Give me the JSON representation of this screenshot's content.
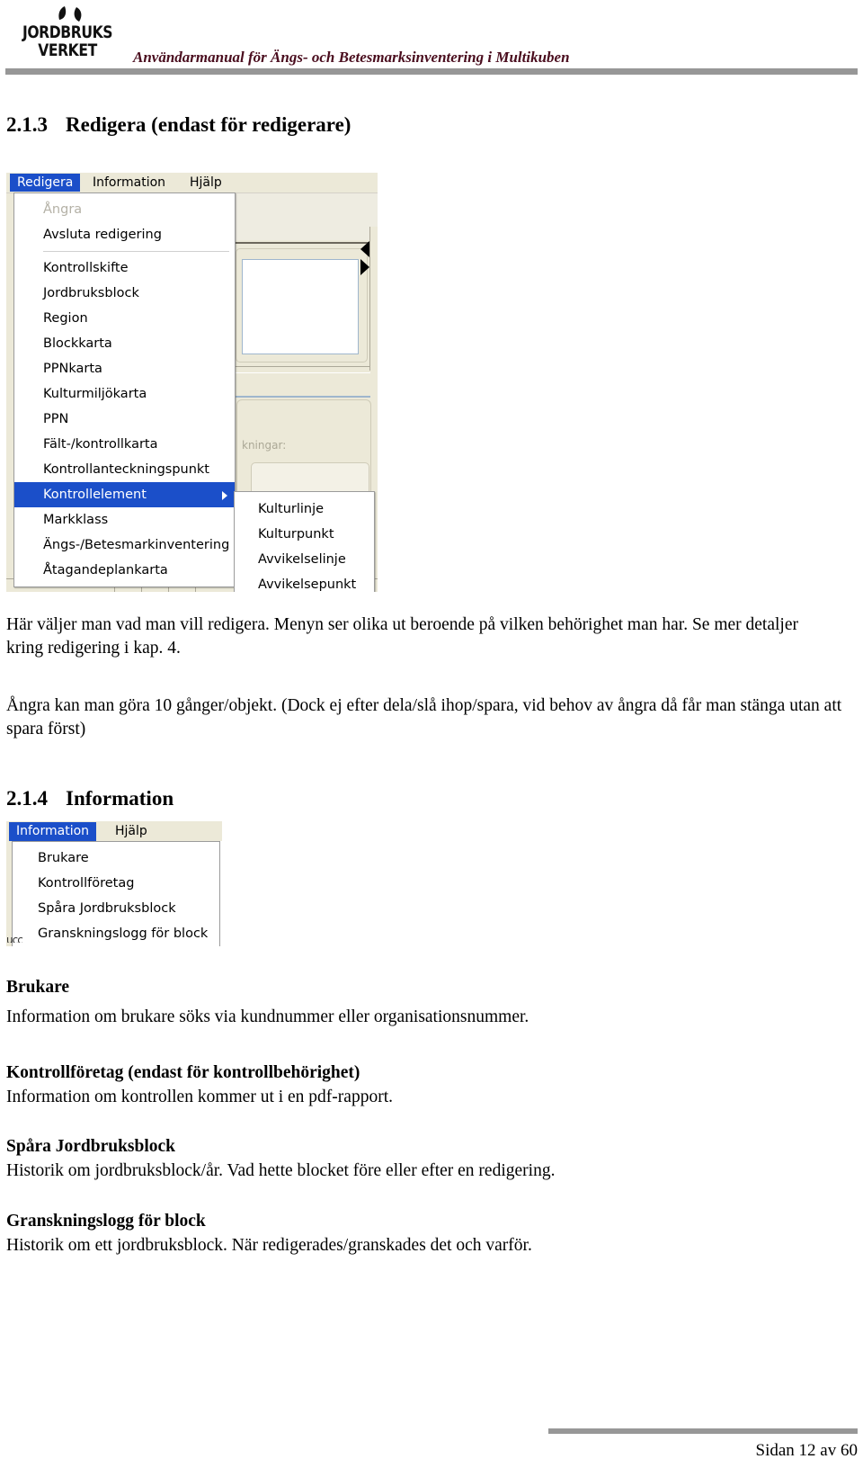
{
  "header": {
    "logo_line1": "JORDBRUKS",
    "logo_line2": "VERKET",
    "title": "Användarmanual för Ängs- och Betesmarksinventering i Multikuben",
    "accent_color": "#4a0d1e",
    "rule_color": "#979797"
  },
  "sections": {
    "s213": {
      "number": "2.1.3",
      "title": "Redigera (endast för redigerare)"
    },
    "s214": {
      "number": "2.1.4",
      "title": "Information"
    }
  },
  "redigera_screenshot": {
    "menubar": [
      {
        "label": "Redigera",
        "active": true
      },
      {
        "label": "Information",
        "active": false
      },
      {
        "label": "Hjälp",
        "active": false
      }
    ],
    "menu_items": [
      {
        "label": "Ångra",
        "state": "disabled"
      },
      {
        "label": "Avsluta redigering",
        "state": "normal"
      },
      {
        "label": "Kontrollskifte",
        "state": "normal"
      },
      {
        "label": "Jordbruksblock",
        "state": "normal"
      },
      {
        "label": "Region",
        "state": "normal"
      },
      {
        "label": "Blockkarta",
        "state": "normal"
      },
      {
        "label": "PPNkarta",
        "state": "normal"
      },
      {
        "label": "Kulturmiljökarta",
        "state": "normal"
      },
      {
        "label": "PPN",
        "state": "normal"
      },
      {
        "label": "Fält-/kontrollkarta",
        "state": "normal"
      },
      {
        "label": "Kontrollanteckningspunkt",
        "state": "normal"
      },
      {
        "label": "Kontrollelement",
        "state": "highlight",
        "has_submenu": true
      },
      {
        "label": "Markklass",
        "state": "normal"
      },
      {
        "label": "Ängs-/Betesmarkinventering",
        "state": "normal"
      },
      {
        "label": "Åtagandeplankarta",
        "state": "normal"
      }
    ],
    "submenu_items": [
      {
        "label": "Kulturlinje"
      },
      {
        "label": "Kulturpunkt"
      },
      {
        "label": "Avvikelselinje"
      },
      {
        "label": "Avvikelsepunkt"
      }
    ],
    "background_label": "kningar:",
    "highlight_color": "#1b4fc9",
    "chrome_color": "#ece9d8"
  },
  "information_screenshot": {
    "menubar": [
      {
        "label": "Information",
        "active": true
      },
      {
        "label": "Hjälp",
        "active": false
      }
    ],
    "menu_items": [
      {
        "label": "Brukare"
      },
      {
        "label": "Kontrollföretag"
      },
      {
        "label": "Spåra Jordbruksblock"
      },
      {
        "label": "Granskningslogg för block"
      }
    ],
    "stray_text": "ucc"
  },
  "body": {
    "p1": "Här väljer man vad man vill redigera. Menyn ser olika ut beroende på vilken behörighet man har. Se mer detaljer kring redigering i kap. 4.",
    "p2": "Ångra kan man göra 10 gånger/objekt. (Dock ej efter dela/slå ihop/spara, vid behov av ångra då får man stänga utan att spara först)",
    "entries": [
      {
        "heading": "Brukare",
        "text": "Information om brukare söks via kundnummer eller organisationsnummer."
      },
      {
        "heading": "Kontrollföretag (endast för kontrollbehörighet)",
        "text": "Information om kontrollen kommer ut i en pdf-rapport."
      },
      {
        "heading": "Spåra Jordbruksblock",
        "text": "Historik om jordbruksblock/år. Vad hette blocket före eller efter en redigering."
      },
      {
        "heading": "Granskningslogg för block",
        "text": "Historik om ett jordbruksblock. När redigerades/granskades det och varför."
      }
    ]
  },
  "footer": {
    "page_label": "Sidan 12 av 60"
  }
}
